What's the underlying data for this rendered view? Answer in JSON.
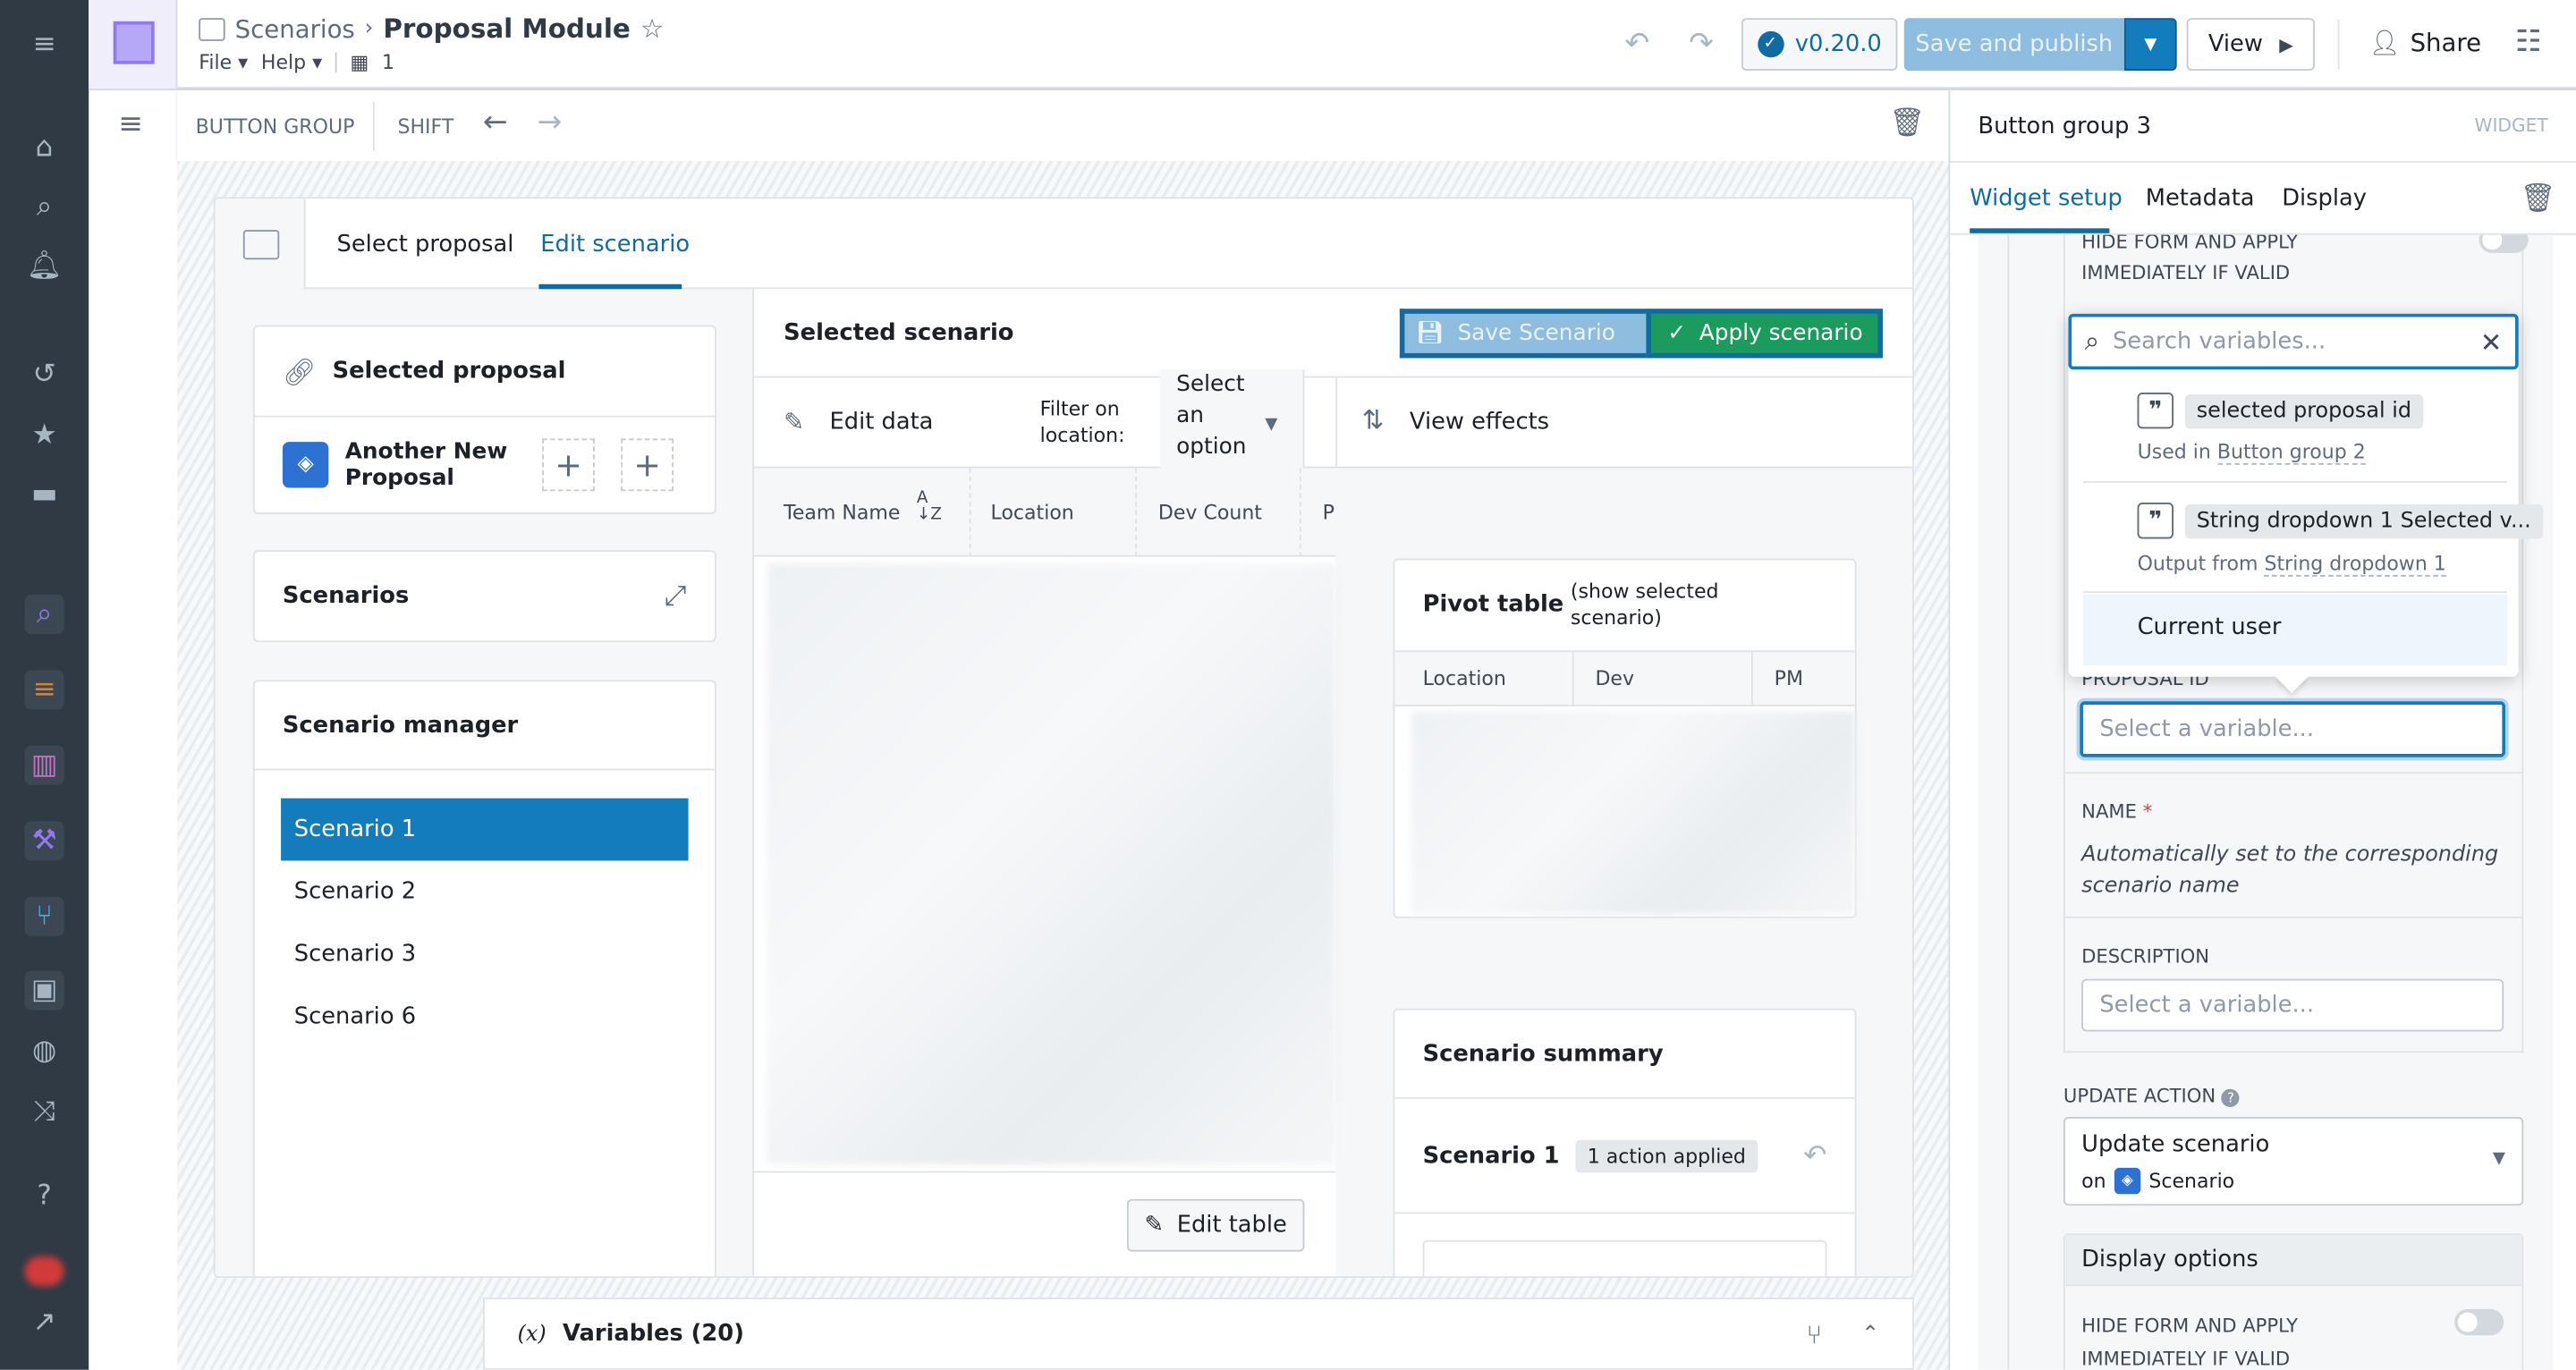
{
  "header": {
    "breadcrumb_parent": "Scenarios",
    "title": "Proposal Module",
    "menu_file": "File",
    "menu_help": "Help",
    "building_count": "1",
    "version": "v0.20.0",
    "save_publish": "Save and publish",
    "view": "View",
    "share": "Share"
  },
  "toolbar": {
    "button_group": "BUTTON GROUP",
    "shift": "SHIFT"
  },
  "widget": {
    "tabs": [
      "Select proposal",
      "Edit scenario"
    ],
    "active_tab": "Edit scenario",
    "selected_proposal": "Selected proposal",
    "proposal_name": "Another New Proposal",
    "scenarios": "Scenarios",
    "scenario_manager": "Scenario manager",
    "scenario_list": [
      "Scenario 1",
      "Scenario 2",
      "Scenario 3",
      "Scenario 6"
    ],
    "selected_scenario_item": "Scenario 1",
    "selected_scenario": "Selected scenario",
    "save_scenario": "Save Scenario",
    "apply_scenario": "Apply scenario",
    "edit_data": "Edit data",
    "filter_label": "Filter on location:",
    "filter_select": "Select an option",
    "view_effects": "View effects",
    "table_columns": [
      "Team Name",
      "Location",
      "Dev Count",
      "P"
    ],
    "edit_table": "Edit table",
    "pivot_title": "Pivot table",
    "pivot_subtitle": "(show selected scenario)",
    "pivot_columns": [
      "Location",
      "Dev",
      "PM"
    ],
    "summary_title": "Scenario summary",
    "summary_scenario": "Scenario 1",
    "summary_badge": "1 action applied"
  },
  "variables_bar": {
    "icon": "(x)",
    "label": "Variables (20)"
  },
  "panel": {
    "title": "Button group 3",
    "type": "WIDGET",
    "tabs": [
      "Widget setup",
      "Metadata",
      "Display"
    ],
    "active_tab": "Widget setup",
    "hide_form_top": "HIDE FORM AND APPLY IMMEDIATELY IF VALID",
    "search_placeholder": "Search variables...",
    "options": [
      {
        "name": "selected proposal id",
        "prefix": "Used in",
        "link": "Button group 2"
      },
      {
        "name": "String dropdown 1 Selected v...",
        "prefix": "Output from",
        "link": "String dropdown 1"
      },
      {
        "name": "Current user"
      }
    ],
    "proposal_id_label": "PROPOSAL ID",
    "proposal_id_placeholder": "Select a variable...",
    "name_label": "NAME",
    "name_required": "*",
    "name_text": "Automatically set to the corresponding scenario name",
    "description_label": "DESCRIPTION",
    "description_placeholder": "Select a variable...",
    "update_action_label": "UPDATE ACTION",
    "update_action_value": "Update scenario",
    "update_action_on": "on",
    "update_action_object": "Scenario",
    "display_options": "Display options",
    "hide_form_bottom": "HIDE FORM AND APPLY IMMEDIATELY IF VALID"
  },
  "colors": {
    "accent": "#106ba3",
    "apply": "#1b9b5e",
    "nav_bg": "#2f3a45",
    "save_disabled": "#8fbde0"
  }
}
